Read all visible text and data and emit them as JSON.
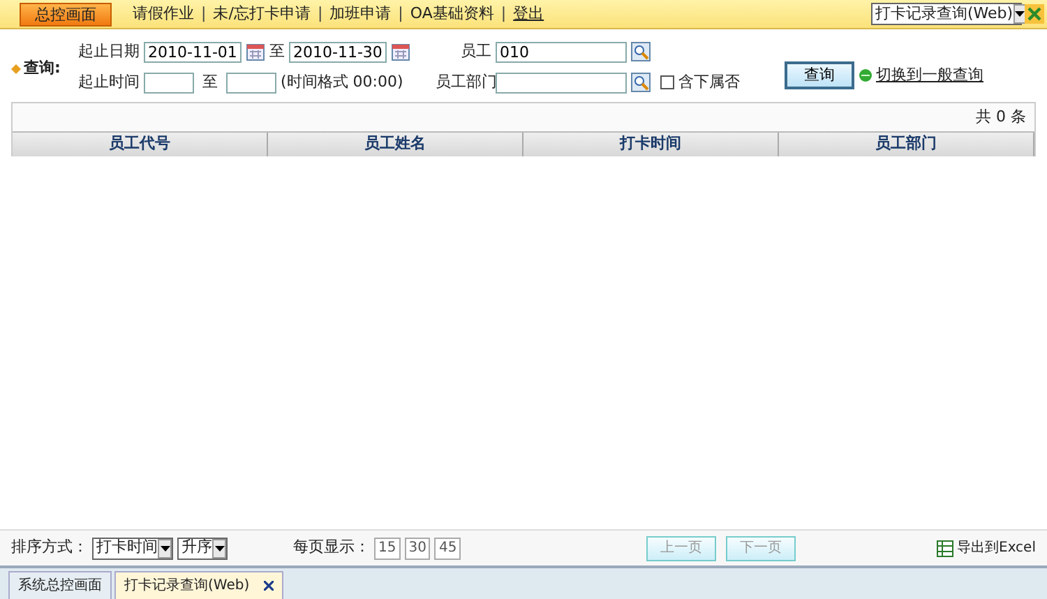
{
  "top_menu": {
    "home_button": "总控画面",
    "items": [
      {
        "label": "请假作业",
        "kind": "menu"
      },
      {
        "label": "未/忘打卡申请",
        "kind": "menu"
      },
      {
        "label": "加班申请",
        "kind": "menu"
      },
      {
        "label": "OA基础资料",
        "kind": "menu"
      },
      {
        "label": "登出",
        "kind": "link"
      }
    ],
    "separator": "|",
    "window_select": "打卡记录查询(Web)"
  },
  "query": {
    "title": "查询:",
    "date_label": "起止日期",
    "date_from": "2010-11-01",
    "date_to_sep": "至",
    "date_to": "2010-11-30",
    "time_label": "起止时间",
    "time_to_sep": "至",
    "time_hint": "(时间格式 00:00)",
    "employee_label": "员工",
    "employee": "010",
    "dept_label": "员工部门",
    "include_sub": {
      "label": "含下属否",
      "checked": false
    },
    "search_button": "查询",
    "switch_link": "切换到一般查询"
  },
  "results": {
    "count": "共 0 条",
    "columns": [
      "员工代号",
      "员工姓名",
      "打卡时间",
      "员工部门"
    ]
  },
  "footer": {
    "sort_label": "排序方式：",
    "sort_field": "打卡时间",
    "sort_order": "升序",
    "per_page_label": "每页显示：",
    "page_sizes": [
      "15",
      "30",
      "45"
    ],
    "prev": {
      "label": "上一页",
      "disabled": true
    },
    "next": {
      "label": "下一页",
      "disabled": true
    },
    "export": "导出到Excel"
  },
  "tabs": [
    {
      "label": "系统总控画面",
      "selected": false,
      "closable": false
    },
    {
      "label": "打卡记录查询(Web)",
      "selected": true,
      "closable": true
    }
  ]
}
